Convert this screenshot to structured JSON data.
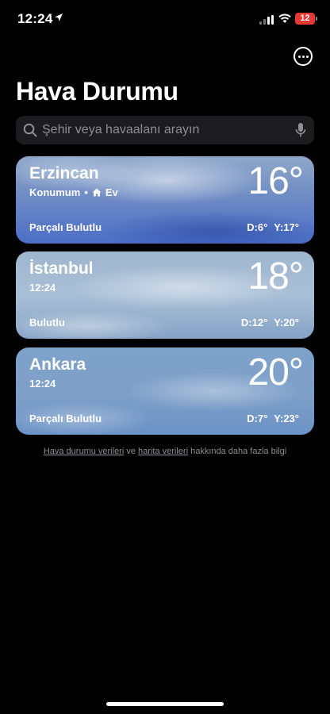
{
  "status_bar": {
    "time": "12:24",
    "battery": "12"
  },
  "header": {
    "title": "Hava Durumu",
    "more_icon": "ellipsis-circle-icon"
  },
  "search": {
    "placeholder": "Şehir veya havaalanı arayın"
  },
  "cards": [
    {
      "city": "Erzincan",
      "subtitle": "Konumum",
      "subtitle_extra": "Ev",
      "temp": "16°",
      "condition": "Parçalı Bulutlu",
      "low": "D:6°",
      "high": "Y:17°"
    },
    {
      "city": "İstanbul",
      "subtitle": "12:24",
      "temp": "18°",
      "condition": "Bulutlu",
      "low": "D:12°",
      "high": "Y:20°"
    },
    {
      "city": "Ankara",
      "subtitle": "12:24",
      "temp": "20°",
      "condition": "Parçalı Bulutlu",
      "low": "D:7°",
      "high": "Y:23°"
    }
  ],
  "footer": {
    "link1": "Hava durumu verileri",
    "word_ve": "ve",
    "link2": "harita verileri",
    "rest": "hakkında daha fazla bilgi"
  },
  "colors": {
    "background": "#000000",
    "search_bg": "#1c1c1e",
    "battery": "#e53935",
    "secondary_text": "#8e8e93"
  }
}
